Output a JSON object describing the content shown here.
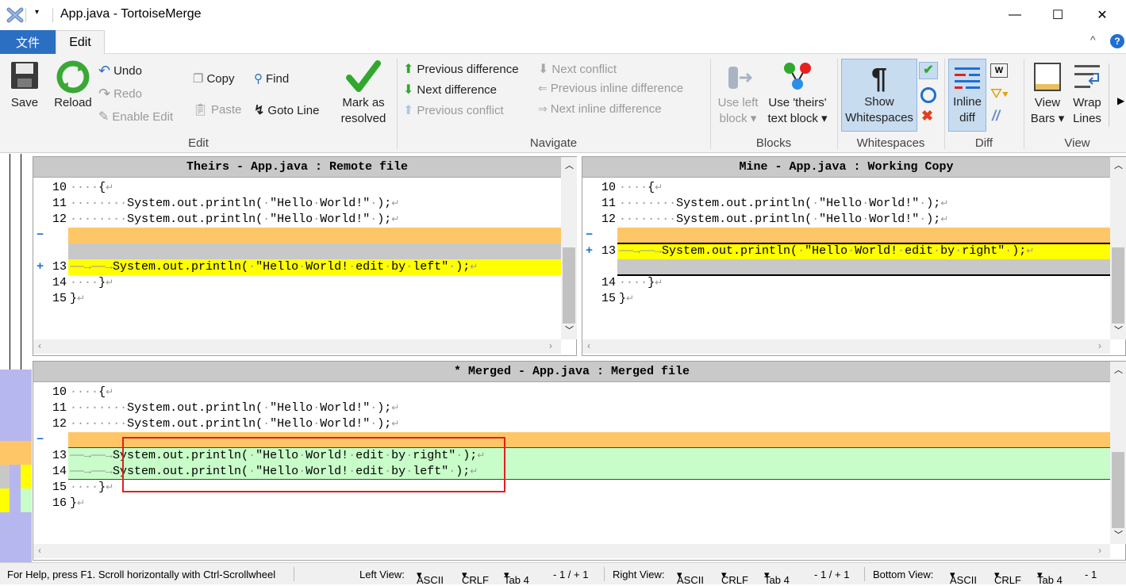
{
  "window": {
    "title": "App.java - TortoiseMerge",
    "min": "—",
    "max": "☐",
    "close": "✕"
  },
  "menu": {
    "file_tab": "文件",
    "edit_tab": "Edit",
    "collapse": "^",
    "help": "?"
  },
  "ribbon": {
    "edit_group": {
      "label": "Edit",
      "save": "Save",
      "reload": "Reload",
      "undo": "Undo",
      "redo": "Redo",
      "enable_edit": "Enable Edit",
      "copy": "Copy",
      "paste": "Paste",
      "find": "Find",
      "goto_line": "Goto Line",
      "mark_resolved_1": "Mark as",
      "mark_resolved_2": "resolved"
    },
    "navigate_group": {
      "label": "Navigate",
      "prev_diff": "Previous difference",
      "next_diff": "Next difference",
      "prev_conflict": "Previous conflict",
      "next_conflict": "Next conflict",
      "prev_inline": "Previous inline difference",
      "next_inline": "Next inline difference"
    },
    "blocks_group": {
      "label": "Blocks",
      "use_left_1": "Use left",
      "use_left_2": "block",
      "use_theirs_1": "Use 'theirs'",
      "use_theirs_2": "text block"
    },
    "whitespaces_group": {
      "label": "Whitespaces",
      "show_ws_1": "Show",
      "show_ws_2": "Whitespaces"
    },
    "diff_group": {
      "label": "Diff",
      "inline_1": "Inline",
      "inline_2": "diff"
    },
    "view_group": {
      "label": "View",
      "view_bars_1": "View",
      "view_bars_2": "Bars",
      "wrap_1": "Wrap",
      "wrap_2": "Lines"
    }
  },
  "panes": {
    "theirs": {
      "header": "Theirs - App.java : Remote file",
      "lines": [
        {
          "num": "10",
          "mark": "",
          "text": "····{",
          "bg": "#ffffff"
        },
        {
          "num": "11",
          "mark": "",
          "text": "········System.out.println(·\"Hello·World!\"·);",
          "bg": "#ffffff"
        },
        {
          "num": "12",
          "mark": "",
          "text": "········System.out.println(·\"Hello·World!\"·);",
          "bg": "#ffffff"
        },
        {
          "num": "",
          "mark": "−",
          "text": "",
          "bg": "#ffc668"
        },
        {
          "num": "",
          "mark": "",
          "text": "",
          "bg": "#c8c8c8"
        },
        {
          "num": "13",
          "mark": "+",
          "text": "——→——→System.out.println(·\"Hello·World!·edit·by·left\"·);",
          "bg": "#ffff00"
        },
        {
          "num": "14",
          "mark": "",
          "text": "····}",
          "bg": "#ffffff"
        },
        {
          "num": "15",
          "mark": "",
          "text": "}",
          "bg": "#ffffff"
        }
      ]
    },
    "mine": {
      "header": "Mine - App.java : Working Copy",
      "lines": [
        {
          "num": "10",
          "mark": "",
          "text": "····{",
          "bg": "#ffffff"
        },
        {
          "num": "11",
          "mark": "",
          "text": "········System.out.println(·\"Hello·World!\"·);",
          "bg": "#ffffff"
        },
        {
          "num": "12",
          "mark": "",
          "text": "········System.out.println(·\"Hello·World!\"·);",
          "bg": "#ffffff"
        },
        {
          "num": "",
          "mark": "−",
          "text": "",
          "bg": "#ffc668"
        },
        {
          "num": "13",
          "mark": "+",
          "text": "——→——→System.out.println(·\"Hello·World!·edit·by·right\"·);",
          "bg": "#ffff00"
        },
        {
          "num": "",
          "mark": "",
          "text": "",
          "bg": "#c8c8c8"
        },
        {
          "num": "14",
          "mark": "",
          "text": "····}",
          "bg": "#ffffff"
        },
        {
          "num": "15",
          "mark": "",
          "text": "}",
          "bg": "#ffffff"
        }
      ]
    },
    "merged": {
      "header": "* Merged - App.java : Merged file",
      "lines": [
        {
          "num": "10",
          "mark": "",
          "text": "····{",
          "bg": "#ffffff"
        },
        {
          "num": "11",
          "mark": "",
          "text": "········System.out.println(·\"Hello·World!\"·);",
          "bg": "#ffffff"
        },
        {
          "num": "12",
          "mark": "",
          "text": "········System.out.println(·\"Hello·World!\"·);",
          "bg": "#ffffff"
        },
        {
          "num": "",
          "mark": "−",
          "text": "",
          "bg": "#ffc668"
        },
        {
          "num": "13",
          "mark": "",
          "text": "——→——→System.out.println(·\"Hello·World!·edit·by·right\"·);",
          "bg": "#c8fcc8"
        },
        {
          "num": "14",
          "mark": "",
          "text": "——→——→System.out.println(·\"Hello·World!·edit·by·left\"·);",
          "bg": "#c8fcc8"
        },
        {
          "num": "15",
          "mark": "",
          "text": "····}",
          "bg": "#ffffff"
        },
        {
          "num": "16",
          "mark": "",
          "text": "}",
          "bg": "#ffffff"
        }
      ]
    }
  },
  "status": {
    "help": "For Help, press F1. Scroll horizontally with Ctrl-Scrollwheel",
    "left_label": "Left View:",
    "left_enc": "ASCII",
    "left_eol": "CRLF",
    "left_tab": "Tab 4",
    "left_pos": "- 1 / + 1",
    "right_label": "Right View:",
    "right_enc": "ASCII",
    "right_eol": "CRLF",
    "right_tab": "Tab 4",
    "right_pos": "- 1 / + 1",
    "bottom_label": "Bottom View:",
    "bottom_enc": "ASCII",
    "bottom_eol": "CRLF",
    "bottom_tab": "Tab 4",
    "bottom_pos": "- 1"
  },
  "colors": {
    "removed": "#ffc668",
    "added": "#ffff00",
    "merged": "#c8fcc8",
    "empty": "#c8c8c8",
    "accent": "#2b6fc2",
    "highlight_box": "#e02020"
  }
}
